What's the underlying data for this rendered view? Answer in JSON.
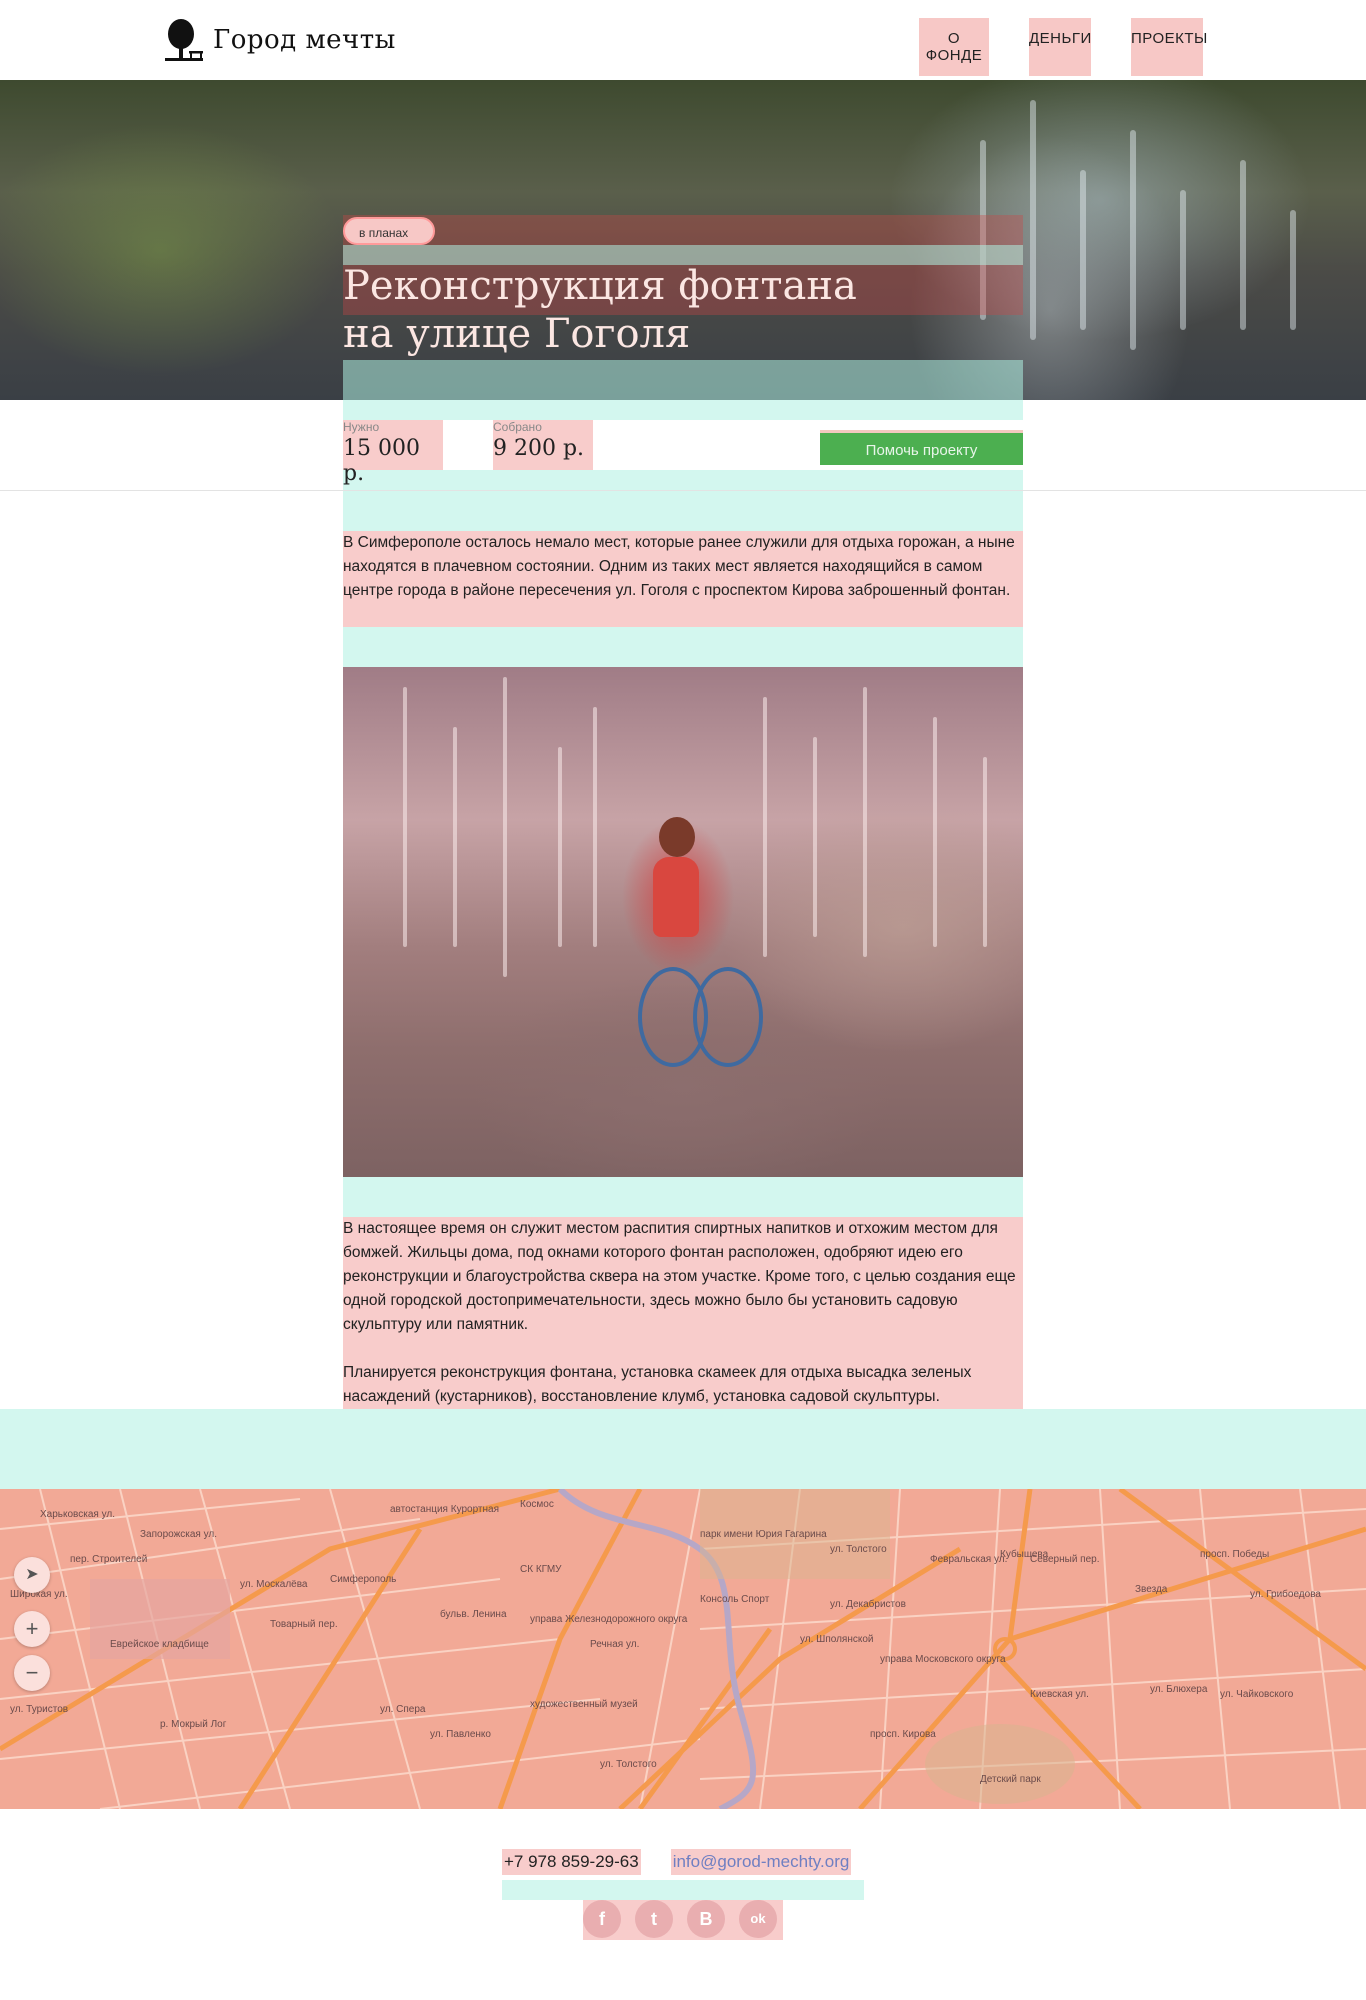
{
  "header": {
    "logo_text": "Город мечты",
    "nav": [
      "О ФОНДЕ",
      "ДЕНЬГИ",
      "ПРОЕКТЫ"
    ]
  },
  "hero": {
    "tag": "в планах",
    "title_line1": "Реконструкция фонтана",
    "title_line2": "на улице Гоголя"
  },
  "funding": {
    "needed_label": "Нужно",
    "needed_value": "15 000 р.",
    "collected_label": "Собрано",
    "collected_value": "9 200 р.",
    "help_button": "Помочь проекту"
  },
  "article": {
    "paragraph1": "В Симферополе осталось немало мест, которые ранее служили для отдыха горожан, а ныне находятся в плачевном состоянии. Одним из таких мест является находящийся в самом центре города в районе пересечения ул. Гоголя с проспектом Кирова заброшенный фонтан.",
    "paragraph2": "В настоящее время он служит местом распития спиртных напитков и отхожим местом для бомжей. Жильцы дома, под окнами которого фонтан расположен, одобряют идею его реконструкции и благоустройства сквера на этом участке. Кроме того, с целью создания еще одной городской достопримечательности, здесь можно было бы установить садовую скульптуру или памятник.",
    "paragraph3": "Планируется реконструкция фонтана, установка скамеек для отдыха высадка зеленых насаждений (кустарников), восстановление клумб, установка садовой скульптуры."
  },
  "map": {
    "labels": [
      "Харьковская ул.",
      "пер. Строителей",
      "Запорожская ул.",
      "Широкая ул.",
      "ул. Москалёва",
      "автостанция Курортная",
      "Космос",
      "СК КГМУ",
      "Симферополь",
      "парк имени Юрия Гагарина",
      "ул. Толстого",
      "Консоль Спорт",
      "управа Железнодорожного округа",
      "бульв. Ленина",
      "Еврейское кладбище",
      "Товарный пер.",
      "Речная ул.",
      "ул. Декабристов",
      "ул. Шполянской",
      "управа Московского округа",
      "Кубышева",
      "Февральская ул.",
      "Северный пер.",
      "просп. Победы",
      "Звезда",
      "ул. Грибоедова",
      "художественный музей",
      "ул. Павленко",
      "просп. Кирова",
      "Киевская ул.",
      "Детский парк",
      "ул. Туристов",
      "р. Мокрый Лог",
      "ул. Блюхера",
      "ул. Чайковского",
      "ул. Спера",
      "ул. Толстого"
    ],
    "controls": [
      "locate-icon",
      "zoom-in-icon",
      "zoom-out-icon"
    ]
  },
  "footer": {
    "phone": "+7 978 859-29-63",
    "email": "info@gorod-mechty.org",
    "socials": [
      "f",
      "t",
      "В",
      "ok"
    ]
  },
  "colors": {
    "accent_green": "#4caf50",
    "overlay_pink": "#f8cccb",
    "overlay_cyan": "#aff0e1",
    "link": "#6f7fc2"
  }
}
